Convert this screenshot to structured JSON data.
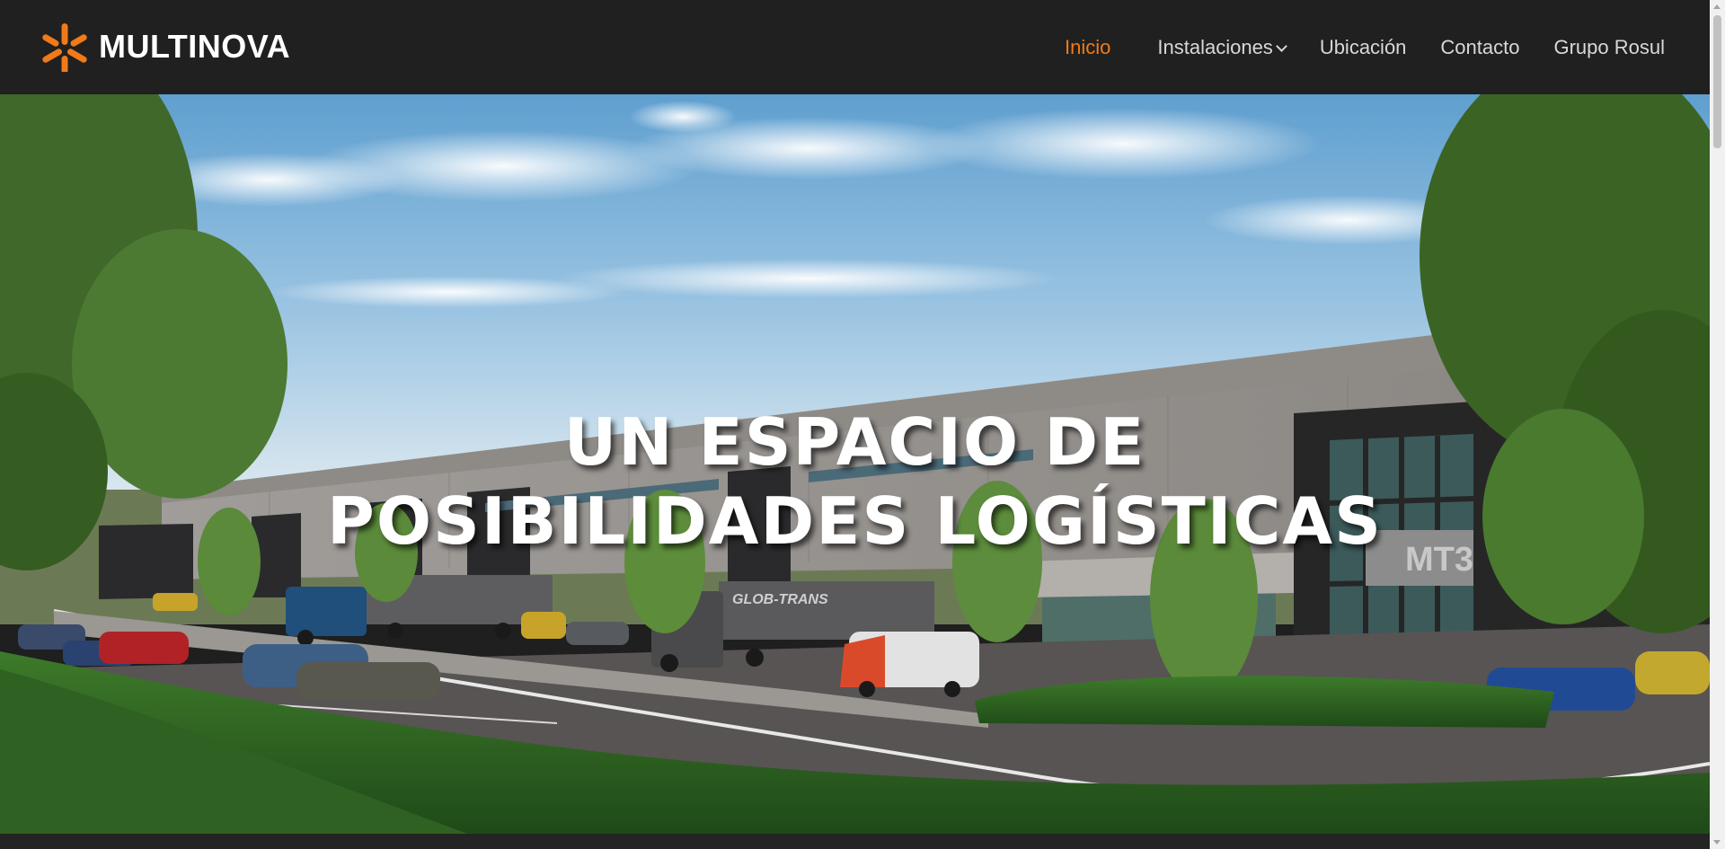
{
  "brand": {
    "name": "MULTINOVA",
    "accent_color": "#f07a1a",
    "logo_icon": "asterisk-star-icon"
  },
  "nav": {
    "items": [
      {
        "label": "Inicio",
        "active": true
      },
      {
        "label": "Instalaciones",
        "has_dropdown": true
      },
      {
        "label": "Ubicación"
      },
      {
        "label": "Contacto"
      },
      {
        "label": "Grupo Rosul"
      }
    ]
  },
  "hero": {
    "title_line1": "UN ESPACIO DE",
    "title_line2": "POSIBILIDADES LOGÍSTICAS",
    "building_sign": "MT3",
    "truck_brand": "GLOB-TRANS"
  }
}
